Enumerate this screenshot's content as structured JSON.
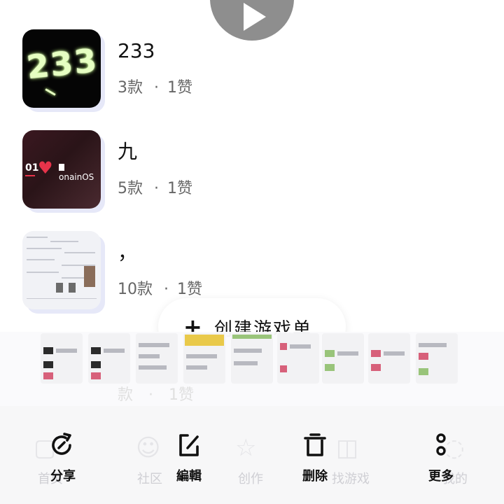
{
  "collections": [
    {
      "title": "233",
      "count": "3款",
      "likes": "1赞"
    },
    {
      "title": "九",
      "count": "5款",
      "likes": "1赞"
    },
    {
      "title": "，",
      "count": "10款",
      "likes": "1赞"
    }
  ],
  "thumbs": {
    "t233_text": "233",
    "jiu_badge": "01",
    "jiu_brand": "onainOS"
  },
  "create_button": {
    "plus": "+",
    "label": "创建游戏单"
  },
  "ghost_meta": {
    "count": "款",
    "likes": "1赞"
  },
  "toolbar": {
    "share": "分享",
    "edit": "編輯",
    "delete": "删除",
    "more": "更多"
  },
  "background_tabs": [
    "首页",
    "社区",
    "创作",
    "找游戏",
    "我的"
  ],
  "colors": {
    "accent_red": "#e6334a",
    "text_secondary": "#666666"
  }
}
